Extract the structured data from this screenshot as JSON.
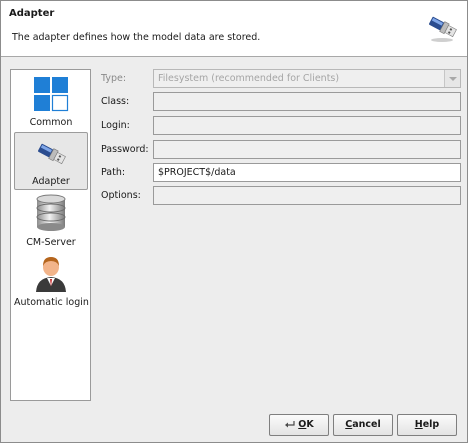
{
  "header": {
    "title": "Adapter",
    "description": "The adapter defines how the model data are stored.",
    "icon": "usb-connector-icon"
  },
  "nav": {
    "items": [
      {
        "label": "Common",
        "icon": "windows-tiles-icon",
        "selected": false
      },
      {
        "label": "Adapter",
        "icon": "usb-connector-icon",
        "selected": true
      },
      {
        "label": "CM-Server",
        "icon": "database-icon",
        "selected": false
      },
      {
        "label": "Automatic login",
        "icon": "user-icon",
        "selected": false
      }
    ]
  },
  "form": {
    "type": {
      "label": "Type:",
      "value": "Filesystem (recommended for Clients)"
    },
    "class": {
      "label": "Class:",
      "value": ""
    },
    "login": {
      "label": "Login:",
      "value": ""
    },
    "password": {
      "label": "Password:",
      "value": ""
    },
    "path": {
      "label": "Path:",
      "value": "$PROJECT$/data"
    },
    "options": {
      "label": "Options:",
      "value": ""
    }
  },
  "buttons": {
    "ok": {
      "mnemonic": "O",
      "rest": "K"
    },
    "cancel": {
      "mnemonic": "C",
      "rest": "ancel"
    },
    "help": {
      "mnemonic": "H",
      "rest": "elp"
    }
  },
  "colors": {
    "tile_blue": "#1f7fd6",
    "header_bg": "#ffffff",
    "dialog_bg": "#ededed"
  }
}
